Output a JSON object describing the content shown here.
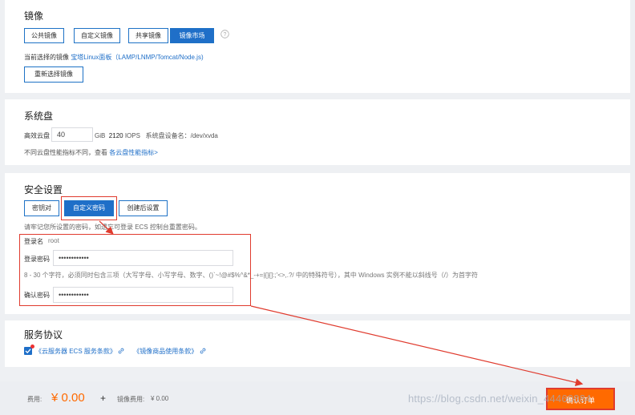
{
  "image": {
    "title": "镜像",
    "tabs": [
      "公共镜像",
      "自定义镜像",
      "共享镜像",
      "镜像市场"
    ],
    "active_tab": 3,
    "current_prefix": "当前选择的镜像",
    "current_name": "宝塔Linux面板（LAMP/LNMP/Tomcat/Node.js)",
    "reselect_label": "重新选择镜像"
  },
  "disk": {
    "title": "系统盘",
    "type_label": "高效云盘",
    "size_value": "40",
    "unit": "GiB",
    "iops_value": "2120",
    "iops_label": "IOPS",
    "device_label": "系统盘设备名：/dev/xvda",
    "note": "不同云盘性能指标不同，查看",
    "note_link": "各云盘性能指标>"
  },
  "security": {
    "title": "安全设置",
    "tabs": [
      "密钥对",
      "自定义密码",
      "创建后设置"
    ],
    "active_tab": 1,
    "hint": "请牢记您所设置的密码，如遗忘可登录 ECS 控制台重置密码。",
    "login_name_label": "登录名",
    "login_name_value": "root",
    "password_label": "登录密码",
    "password_value": "••••••••••••",
    "rule": "8 - 30 个字符，必须同时包含三项（大写字母、小写字母、数字、()`~!@#$%^&*_-+=|{}[]:;'<>,.?/ 中的特殊符号），其中 Windows 实例不能以斜线号（/）为首字符",
    "confirm_label": "确认密码",
    "confirm_value": "••••••••••••"
  },
  "agreement": {
    "title": "服务协议",
    "item1": "《云服务器 ECS 服务条款》",
    "item2": "《镜像商品使用条款》"
  },
  "footer": {
    "fee_label": "费用:",
    "fee_value": "¥ 0.00",
    "plus": "+",
    "image_fee_label": "镜像费用:",
    "image_fee_value": "¥ 0.00",
    "confirm_button": "确认订单",
    "watermark": "https://blog.csdn.net/weixin_44460884"
  },
  "colors": {
    "primary": "#1f6fc8",
    "orange": "#ff6a00",
    "annotation_red": "#e03b2e"
  }
}
